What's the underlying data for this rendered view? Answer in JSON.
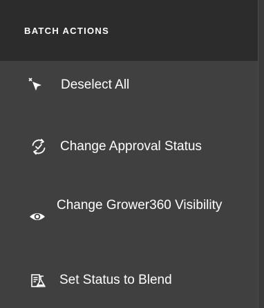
{
  "panel": {
    "title": "BATCH ACTIONS"
  },
  "actions": [
    {
      "label": "Deselect All",
      "icon": "deselect-cursor-icon"
    },
    {
      "label": "Change Approval Status",
      "icon": "refresh-check-icon"
    },
    {
      "label": "Change Grower360 Visibility",
      "icon": "eye-icon"
    },
    {
      "label": "Set Status to Blend",
      "icon": "flask-blend-icon"
    }
  ],
  "colors": {
    "header_bg": "#2c2c2c",
    "panel_bg": "#404040",
    "text": "#ffffff"
  }
}
